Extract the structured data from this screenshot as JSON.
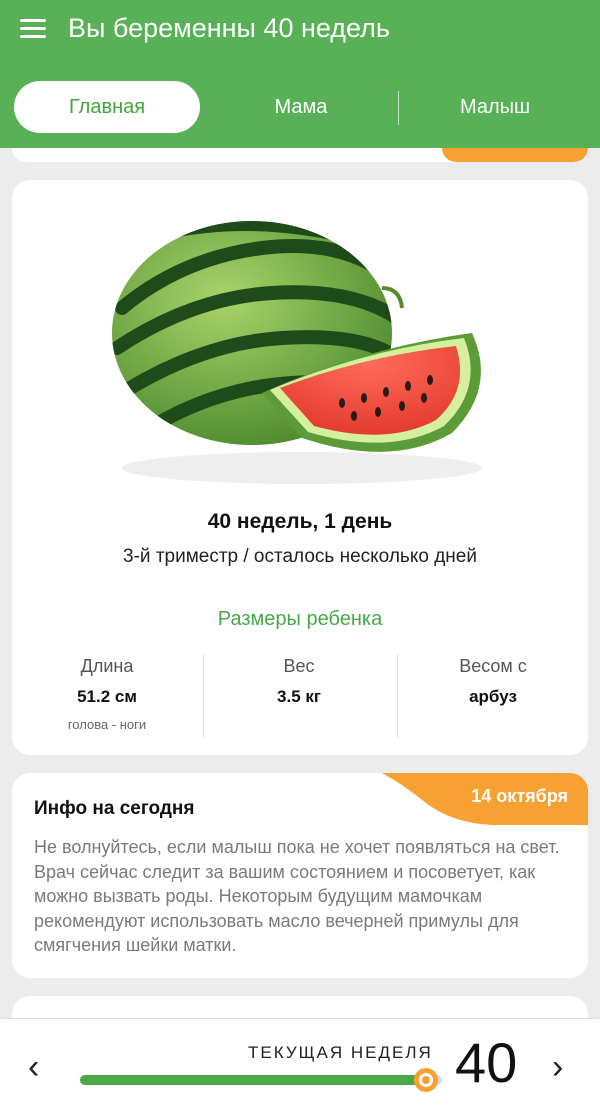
{
  "header": {
    "title": "Вы беременны 40 недель",
    "menu_icon": "hamburger-menu-icon"
  },
  "tabs": [
    {
      "label": "Главная",
      "active": true
    },
    {
      "label": "Мама",
      "active": false
    },
    {
      "label": "Малыш",
      "active": false
    }
  ],
  "week_card": {
    "image": "watermelon-image",
    "week_day": "40 недель, 1 день",
    "trimester": "3-й триместр / осталось несколько дней",
    "sizes_title": "Размеры ребенка",
    "stats": [
      {
        "label": "Длина",
        "value": "51.2 см",
        "sub": "голова - ноги"
      },
      {
        "label": "Вес",
        "value": "3.5 кг"
      },
      {
        "label": "Весом с",
        "value": "арбуз"
      }
    ]
  },
  "info_card": {
    "title": "Инфо на сегодня",
    "date": "14 октября",
    "text": "Не волнуйтесь, если малыш пока не хочет появляться на свет. Врач сейчас следит за вашим состоянием и посоветует, как можно вызвать роды. Некоторым будущим мамочкам рекомендуют использовать масло вечерней примулы для смягчения шейки матки."
  },
  "bottom_bar": {
    "label": "ТЕКУЩАЯ НЕДЕЛЯ",
    "week": "40",
    "progress": 1.0,
    "prev_icon": "chevron-left-icon",
    "next_icon": "chevron-right-icon"
  },
  "colors": {
    "green": "#58b156",
    "orange": "#f7a132"
  }
}
